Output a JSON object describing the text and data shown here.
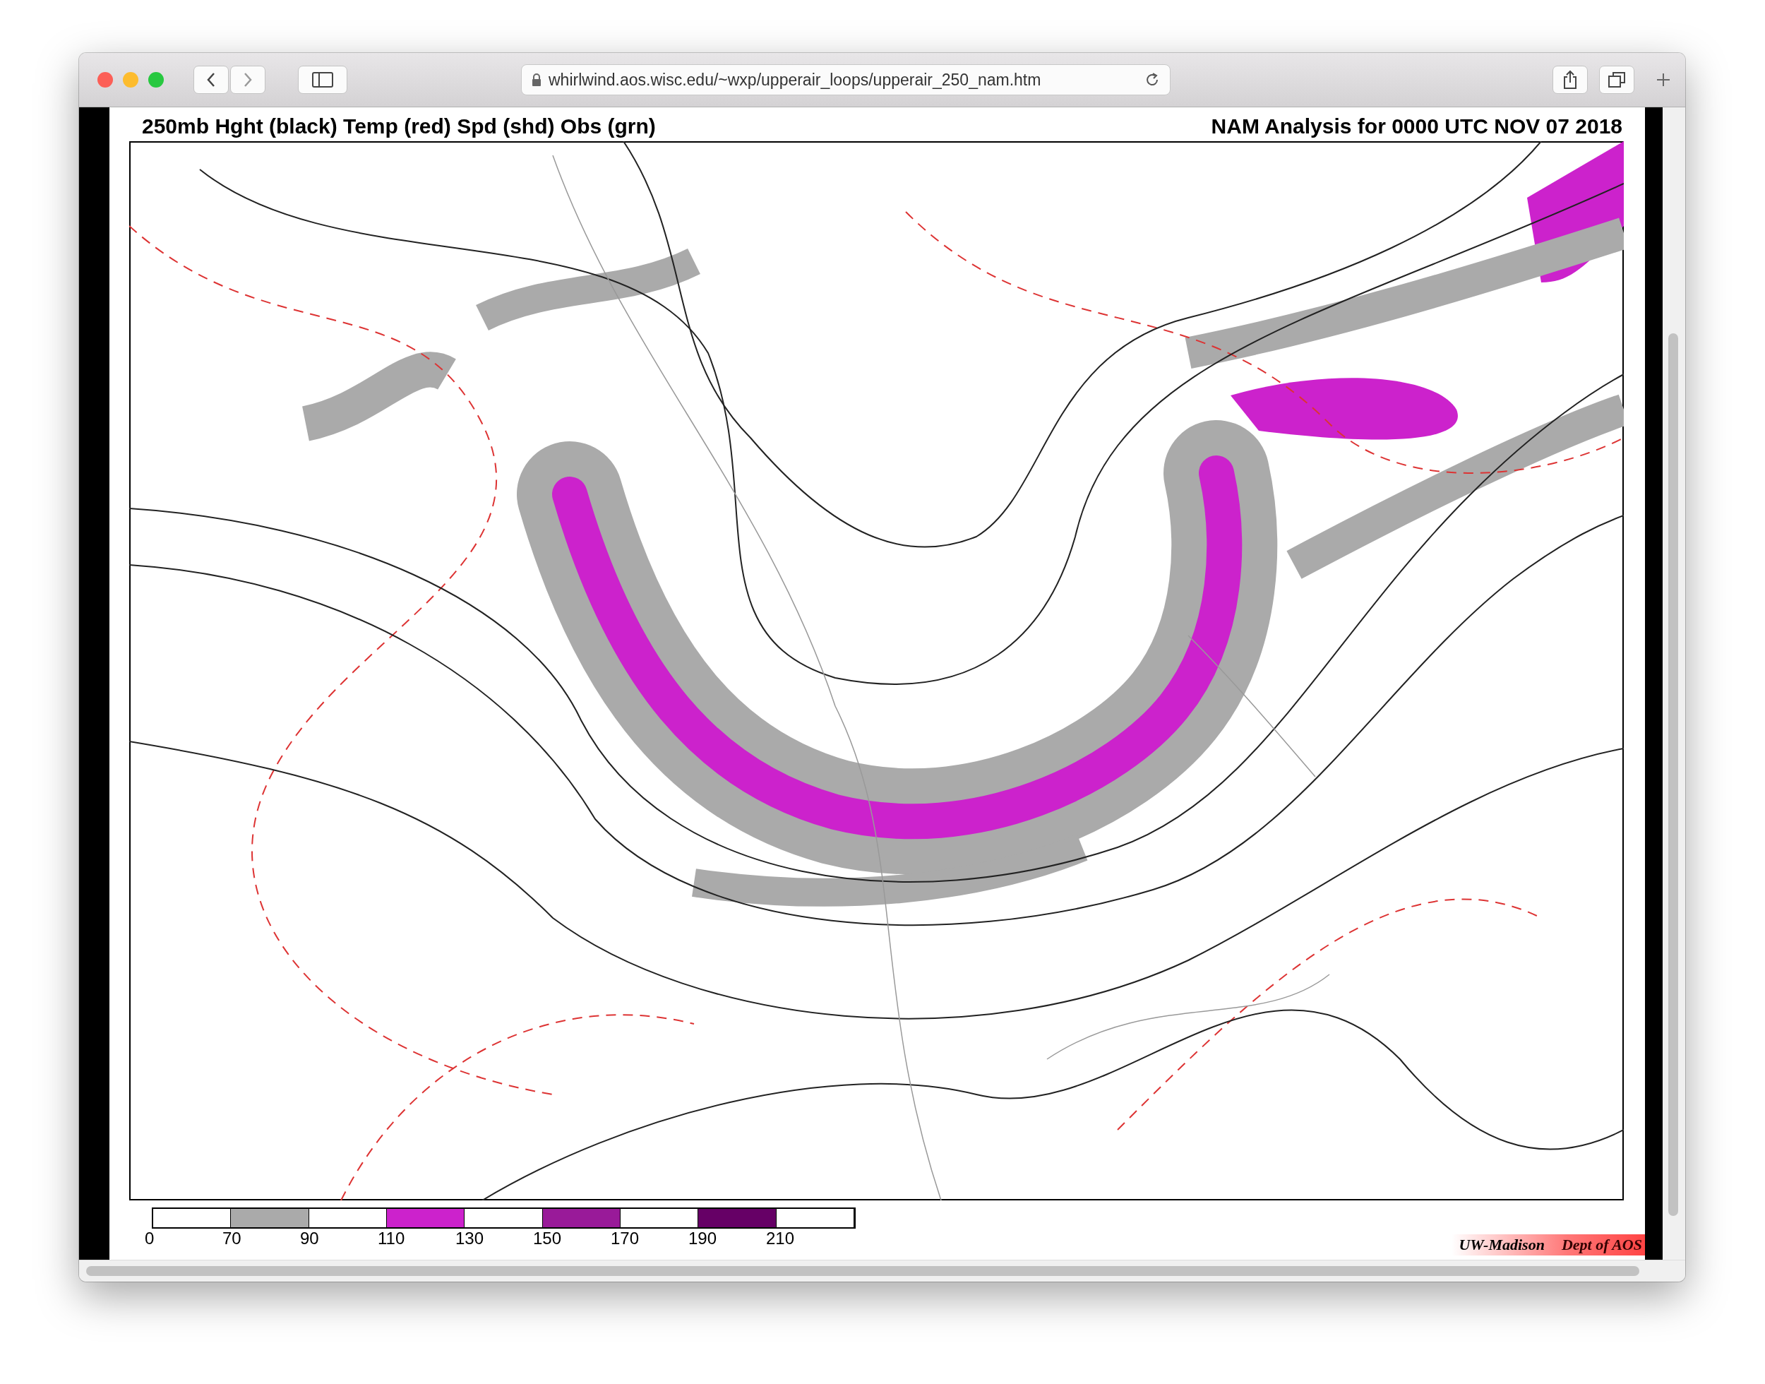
{
  "browser": {
    "url": "whirlwind.aos.wisc.edu/~wxp/upperair_loops/upperair_250_nam.htm"
  },
  "map": {
    "title": "250mb Hght (black) Temp (red) Spd (shd) Obs (grn)",
    "subtitle": "NAM Analysis for 0000 UTC  NOV 07 2018"
  },
  "legend": {
    "segments": [
      {
        "color": "#ffffff"
      },
      {
        "color": "#aaaaaa"
      },
      {
        "color": "#ffffff"
      },
      {
        "color": "#cc22cc"
      },
      {
        "color": "#ffffff"
      },
      {
        "color": "#991a99"
      },
      {
        "color": "#ffffff"
      },
      {
        "color": "#660066"
      },
      {
        "color": "#ffffff"
      }
    ],
    "ticks": [
      "0",
      "70",
      "90",
      "110",
      "130",
      "150",
      "170",
      "190",
      "210"
    ]
  },
  "credit": {
    "left": "UW-Madison",
    "right": "Dept of AOS"
  }
}
